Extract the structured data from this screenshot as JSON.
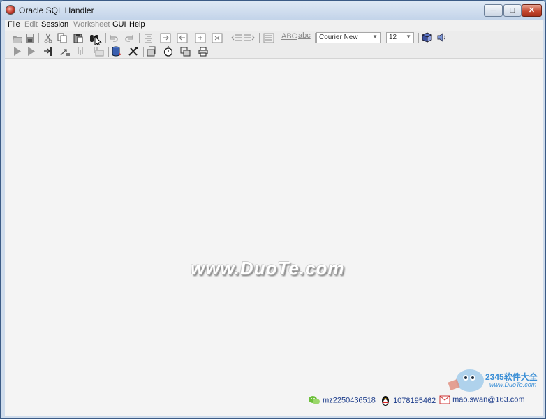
{
  "window": {
    "title": "Oracle SQL Handler"
  },
  "menu": {
    "items": [
      {
        "label": "File",
        "enabled": true
      },
      {
        "label": "Edit",
        "enabled": false
      },
      {
        "label": "Session",
        "enabled": true
      },
      {
        "label": "Worksheet",
        "enabled": false
      },
      {
        "label": "GUI",
        "enabled": true
      },
      {
        "label": "Help",
        "enabled": true
      }
    ]
  },
  "toolbar": {
    "font_name": "Courier New",
    "font_size": "12",
    "abc_upper": "ABC",
    "abc_lower": "abc"
  },
  "content": {
    "watermark": "www.DuoTe.com"
  },
  "logo": {
    "brand": "2345软件大全",
    "url": "www.DuoTe.com"
  },
  "status": {
    "wechat": "mz2250436518",
    "qq": "1078195462",
    "email": "mao.swan@163.com"
  },
  "colors": {
    "title_bg": "#c3d4e9",
    "close_btn": "#c2442c",
    "link_text": "#1b3b8a"
  }
}
